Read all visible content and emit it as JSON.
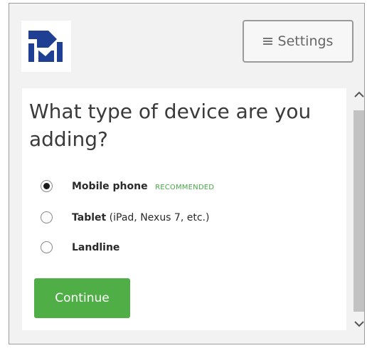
{
  "header": {
    "logo_icon": "brand-logo-icon",
    "settings_label": "Settings",
    "settings_icon": "menu-icon"
  },
  "form": {
    "question": "What type of device are you adding?",
    "options": [
      {
        "label": "Mobile phone",
        "sub": "",
        "badge": "RECOMMENDED",
        "selected": true
      },
      {
        "label": "Tablet",
        "sub": "(iPad, Nexus 7, etc.)",
        "badge": "",
        "selected": false
      },
      {
        "label": "Landline",
        "sub": "",
        "badge": "",
        "selected": false
      }
    ],
    "continue_label": "Continue"
  },
  "colors": {
    "accent_green": "#4fae45",
    "badge_green": "#4aa64a",
    "logo_blue": "#1f3f93"
  },
  "scrollbar": {
    "up_icon": "chevron-up-icon",
    "down_icon": "chevron-down-icon"
  }
}
